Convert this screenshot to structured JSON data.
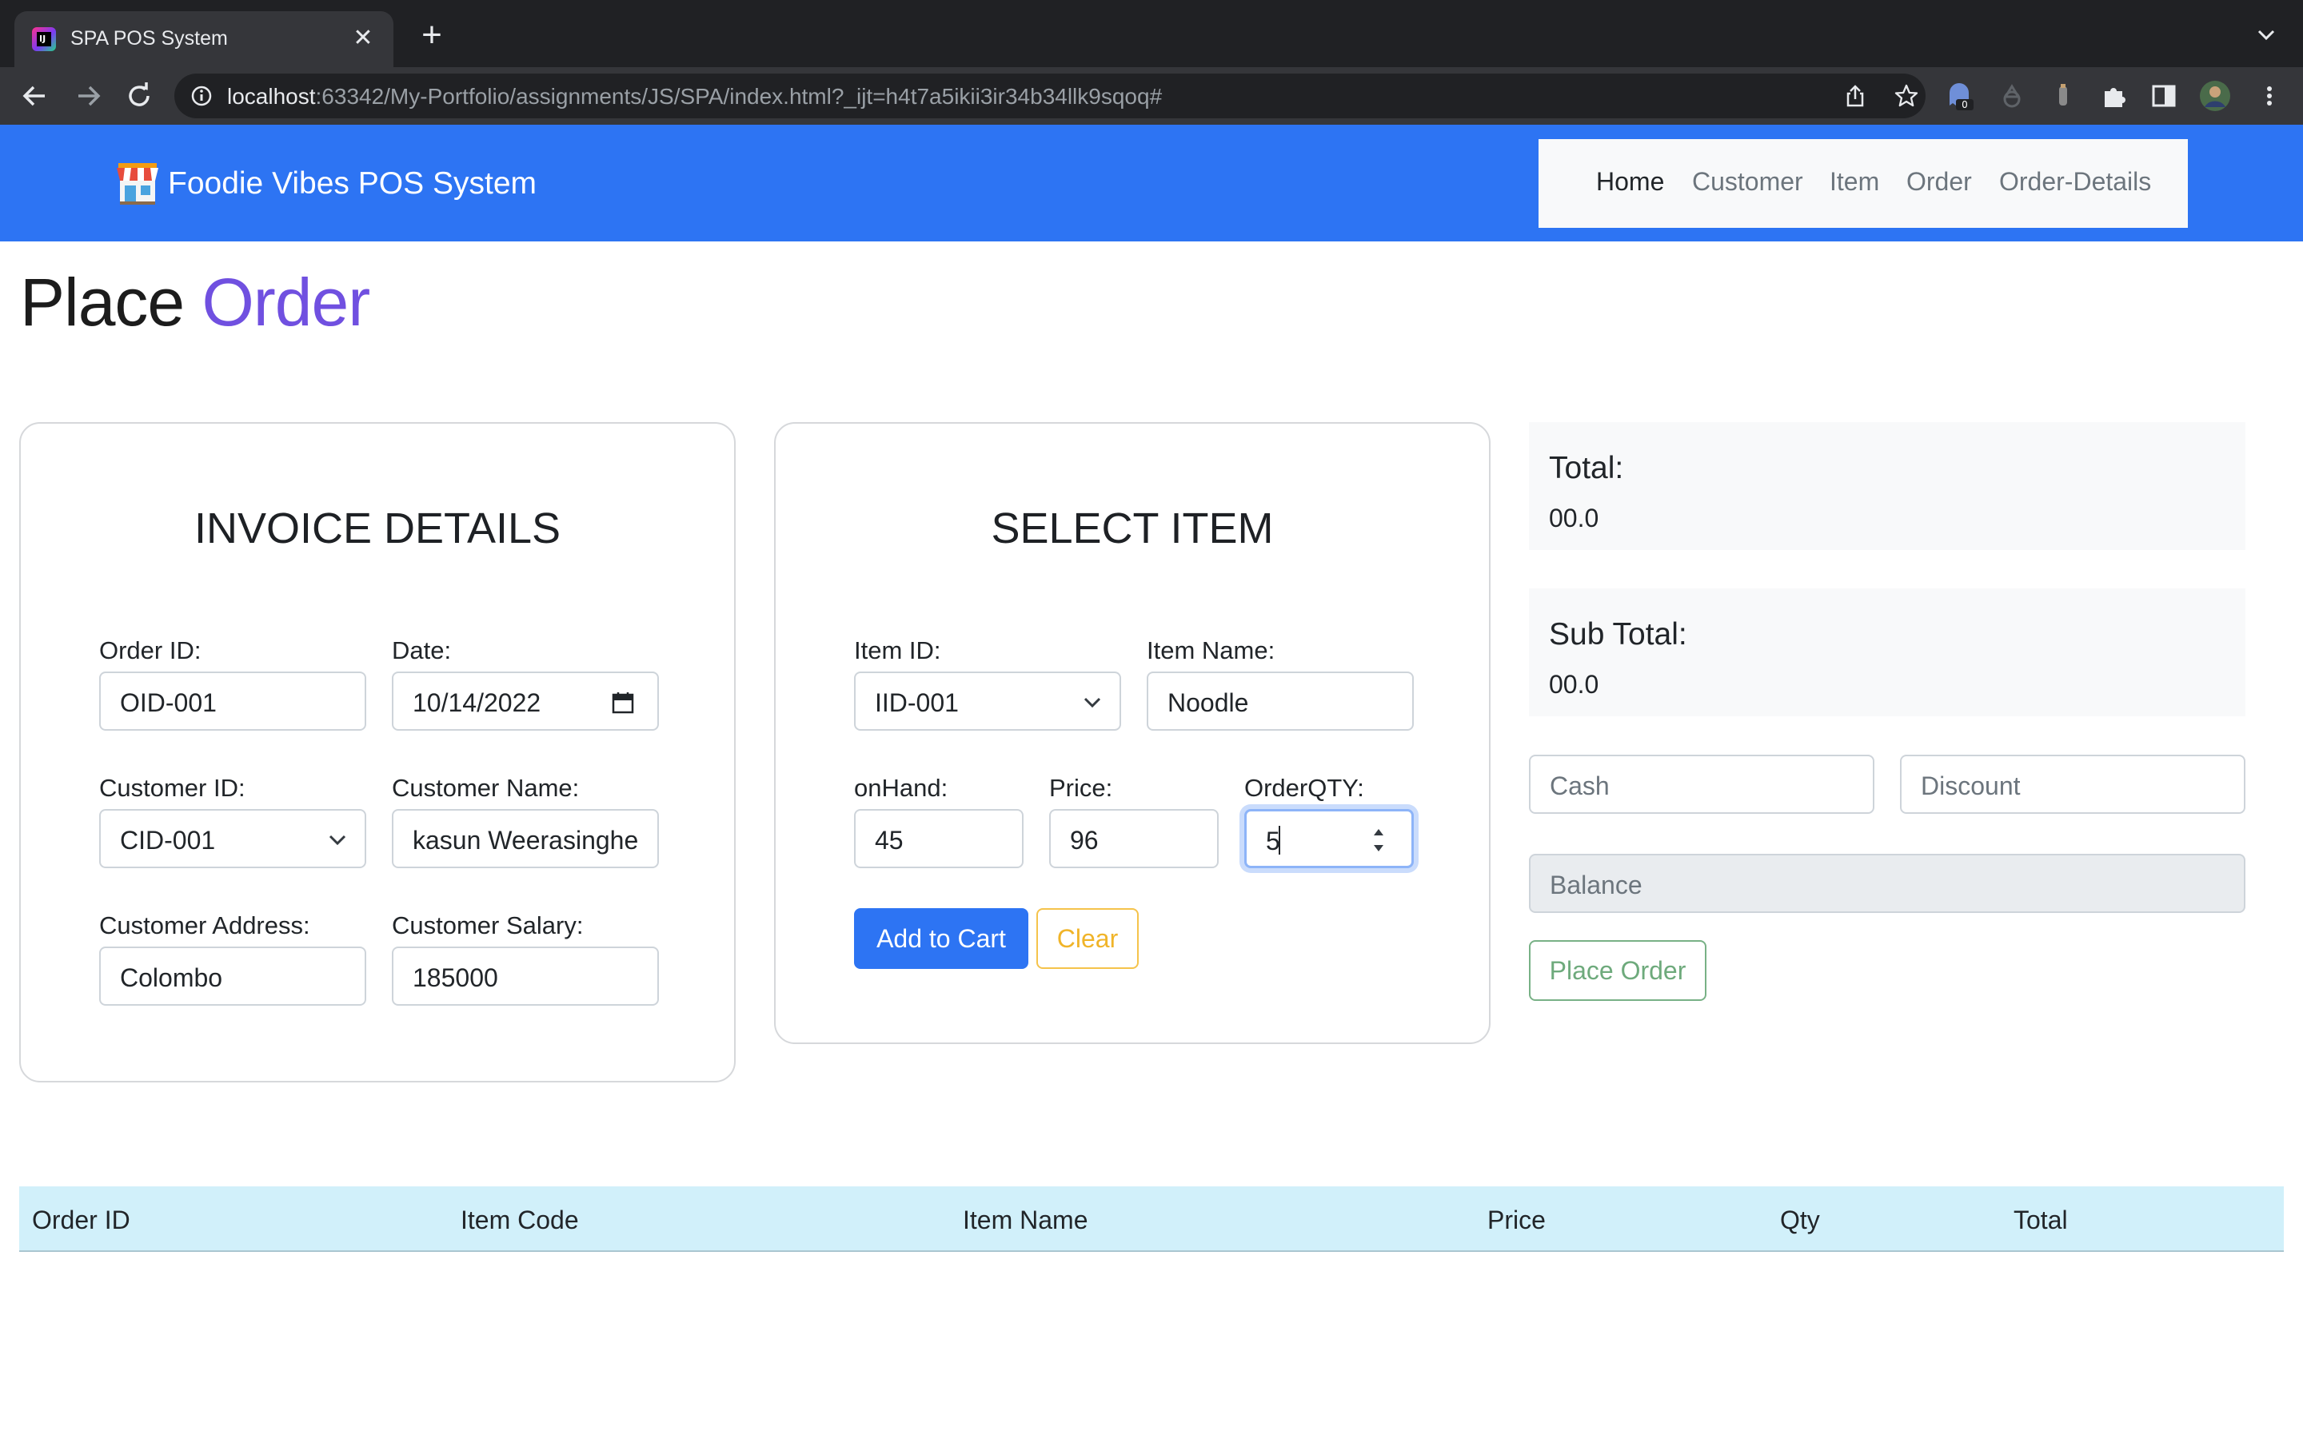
{
  "browser": {
    "tab_title": "SPA POS System",
    "url_host": "localhost",
    "url_rest": ":63342/My-Portfolio/assignments/JS/SPA/index.html?_ijt=h4t7a5ikii3ir34b34llk9sqoq#",
    "extension_badge": "0"
  },
  "navbar": {
    "brand": "Foodie Vibes POS System",
    "links": [
      "Home",
      "Customer",
      "Item",
      "Order",
      "Order-Details"
    ],
    "active": "Home"
  },
  "page": {
    "title_part1": "Place",
    "title_part2": "Order"
  },
  "invoice": {
    "title": "INVOICE DETAILS",
    "order_id_label": "Order ID:",
    "order_id": "OID-001",
    "date_label": "Date:",
    "date": "10/14/2022",
    "customer_id_label": "Customer ID:",
    "customer_id": "CID-001",
    "customer_name_label": "Customer Name:",
    "customer_name": "kasun Weerasinghe",
    "customer_address_label": "Customer Address:",
    "customer_address": "Colombo",
    "customer_salary_label": "Customer Salary:",
    "customer_salary": "185000"
  },
  "select_item": {
    "title": "SELECT ITEM",
    "item_id_label": "Item ID:",
    "item_id": "IID-001",
    "item_name_label": "Item Name:",
    "item_name": "Noodle",
    "on_hand_label": "onHand:",
    "on_hand": "45",
    "price_label": "Price:",
    "price": "96",
    "order_qty_label": "OrderQTY:",
    "order_qty": "5",
    "add_to_cart": "Add to Cart",
    "clear": "Clear"
  },
  "summary": {
    "total_label": "Total:",
    "total": "00.0",
    "sub_total_label": "Sub Total:",
    "sub_total": "00.0",
    "cash_placeholder": "Cash",
    "discount_placeholder": "Discount",
    "balance_placeholder": "Balance",
    "place_order": "Place Order"
  },
  "table": {
    "headers": [
      "Order ID",
      "Item Code",
      "Item Name",
      "Price",
      "Qty",
      "Total"
    ]
  },
  "colors": {
    "navbar": "#2d74f3",
    "accent": "#7050e0",
    "primary": "#2d74f3",
    "warning": "#f0b429",
    "success": "#6eaa7c",
    "table_header": "#d1f0fa"
  }
}
